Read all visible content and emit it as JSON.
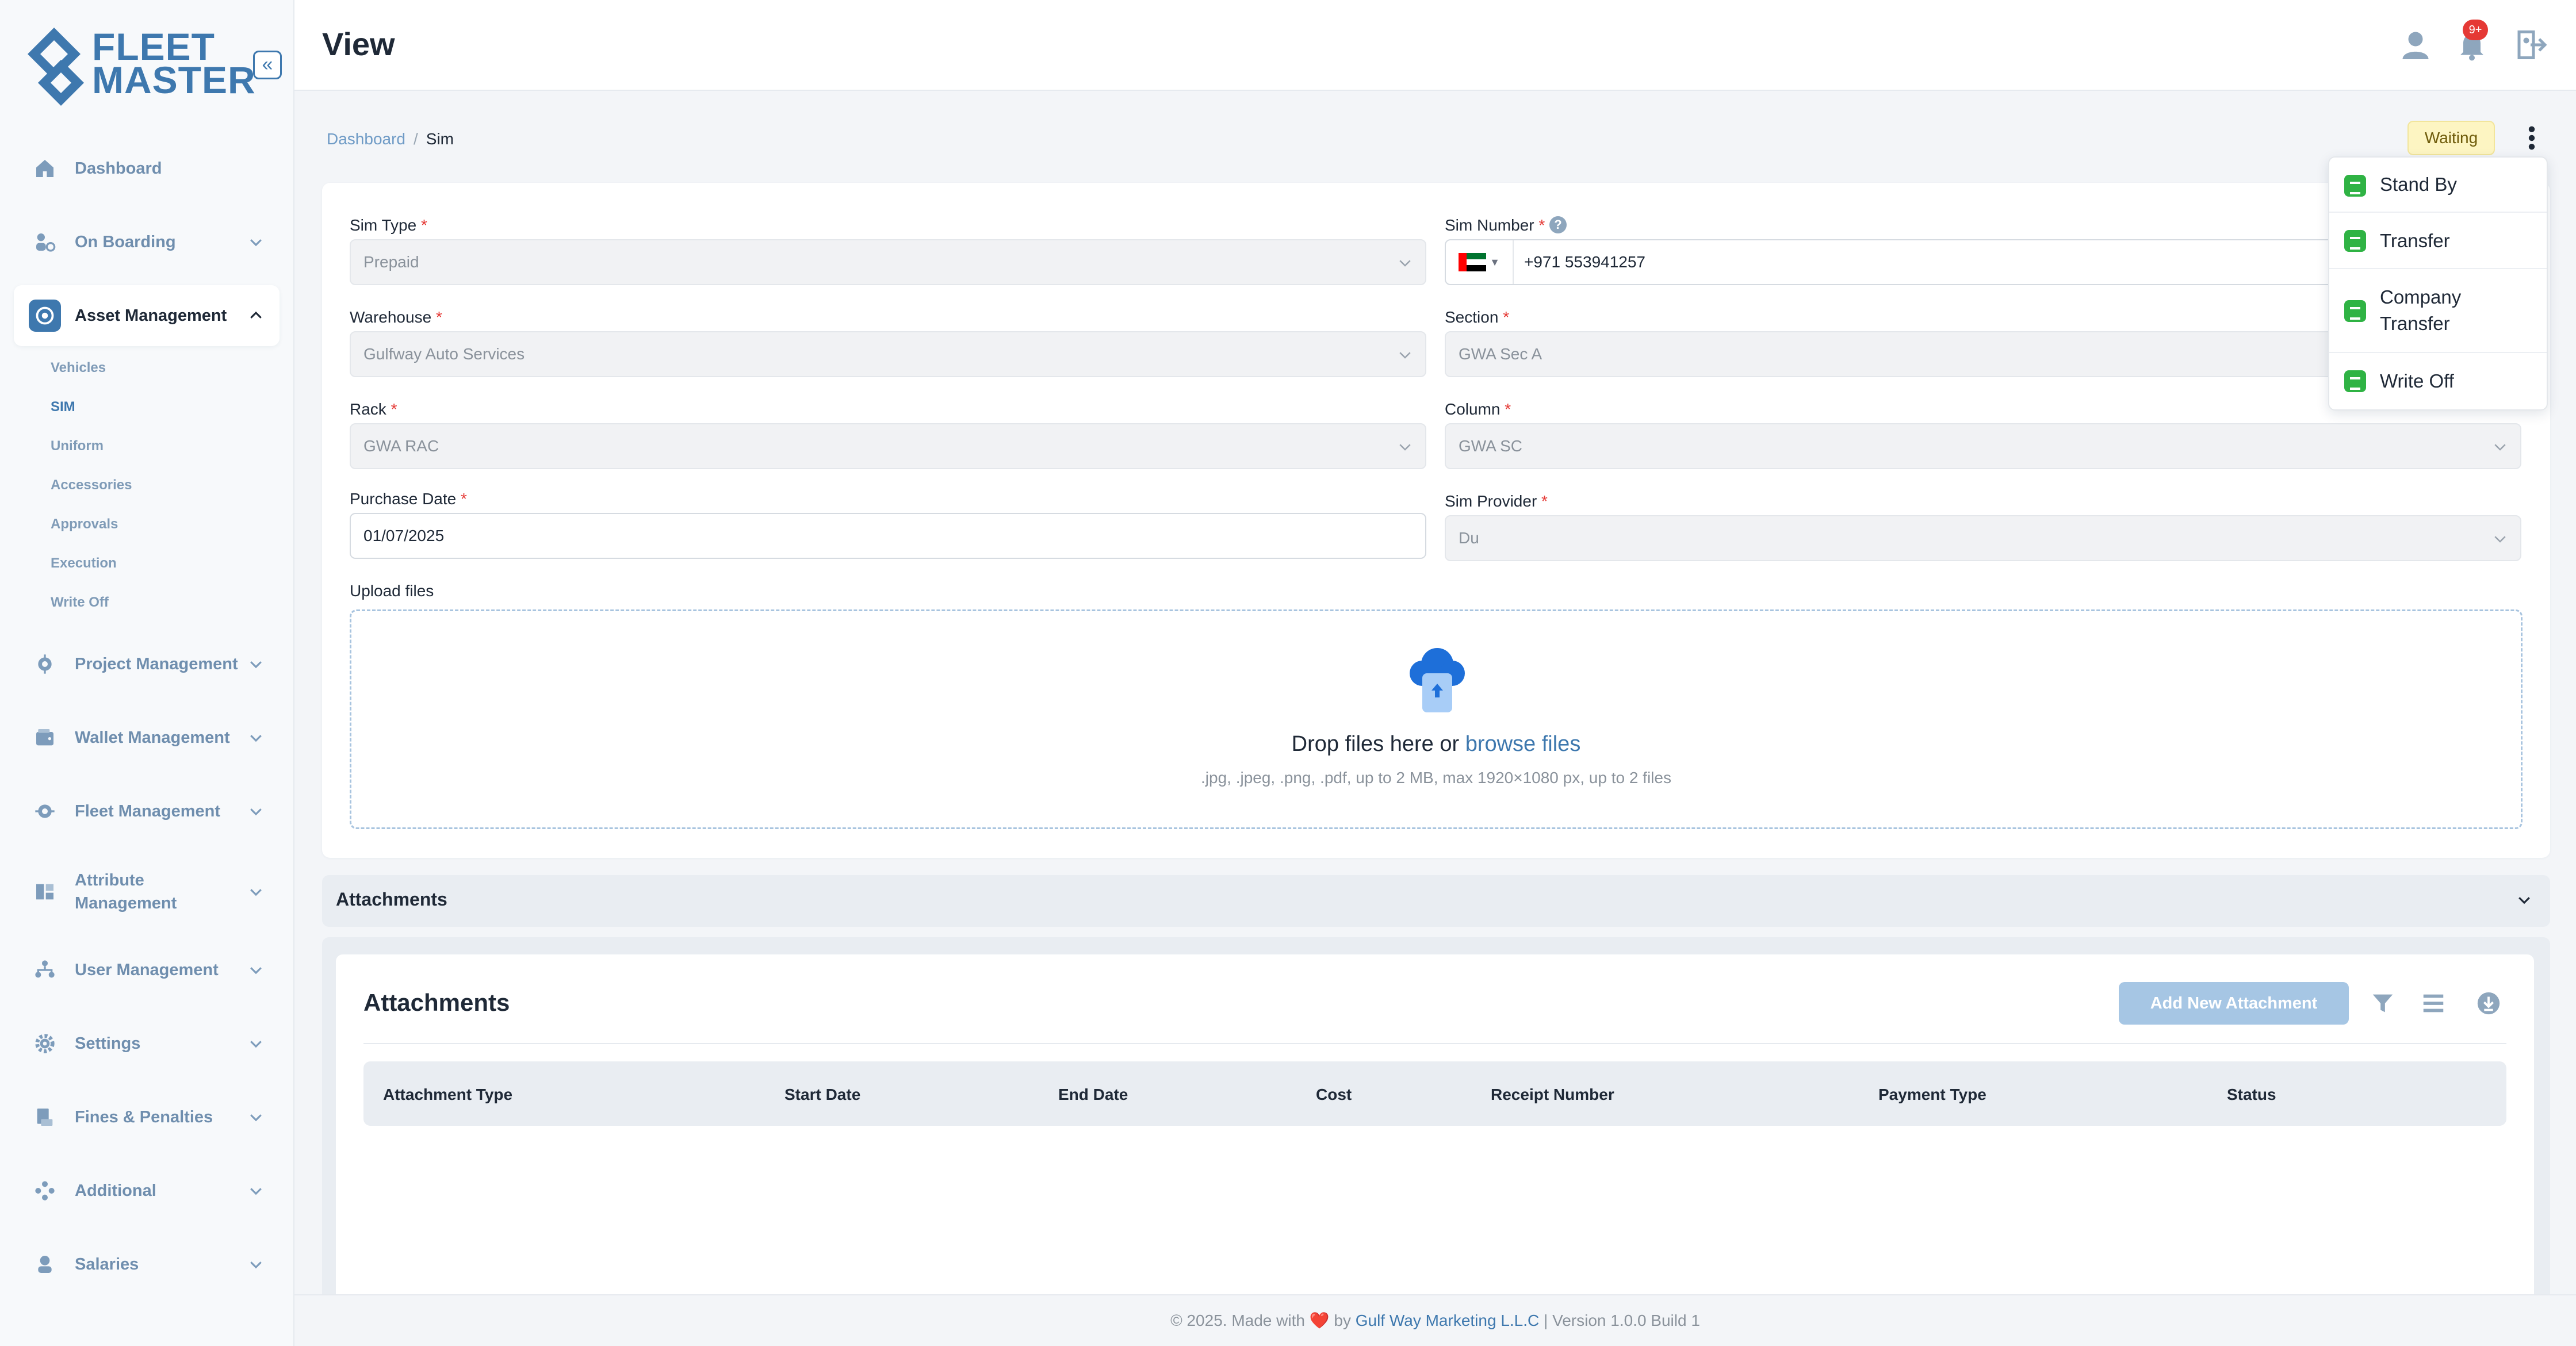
{
  "app": {
    "logo_line1": "FLEET",
    "logo_line2": "MASTER",
    "brand_color": "#3e78ae"
  },
  "sidebar": {
    "items": [
      {
        "label": "Dashboard",
        "icon": "home-icon"
      },
      {
        "label": "On Boarding",
        "icon": "onboarding-icon"
      },
      {
        "label": "Asset Management",
        "icon": "asset-icon",
        "expanded": true
      },
      {
        "label": "Project Management",
        "icon": "project-icon"
      },
      {
        "label": "Wallet Management",
        "icon": "wallet-icon"
      },
      {
        "label": "Fleet Management",
        "icon": "fleet-icon"
      },
      {
        "label": "Attribute Management",
        "icon": "attribute-icon"
      },
      {
        "label": "User Management",
        "icon": "users-icon"
      },
      {
        "label": "Settings",
        "icon": "gear-icon"
      },
      {
        "label": "Fines & Penalties",
        "icon": "fines-icon"
      },
      {
        "label": "Additional",
        "icon": "additional-icon"
      },
      {
        "label": "Salaries",
        "icon": "salaries-icon"
      }
    ],
    "subitems": [
      "Vehicles",
      "SIM",
      "Uniform",
      "Accessories",
      "Approvals",
      "Execution",
      "Write Off"
    ],
    "active_subitem": "SIM"
  },
  "header": {
    "title": "View",
    "notification_count": "9+"
  },
  "breadcrumb": {
    "parent": "Dashboard",
    "separator": "/",
    "current": "Sim"
  },
  "status": {
    "label": "Waiting",
    "menu": [
      "Stand By",
      "Transfer",
      "Company Transfer",
      "Write Off"
    ]
  },
  "form": {
    "sim_type": {
      "label": "Sim Type",
      "value": "Prepaid"
    },
    "sim_number": {
      "label": "Sim Number",
      "value": "+971 553941257",
      "country": "AE"
    },
    "warehouse": {
      "label": "Warehouse",
      "value": "Gulfway Auto Services"
    },
    "section": {
      "label": "Section",
      "value": "GWA Sec A"
    },
    "rack": {
      "label": "Rack",
      "value": "GWA RAC"
    },
    "column": {
      "label": "Column",
      "value": "GWA SC"
    },
    "purchase_date": {
      "label": "Purchase Date",
      "value": "01/07/2025"
    },
    "sim_provider": {
      "label": "Sim Provider",
      "value": "Du"
    },
    "required_mark": "*",
    "help_mark": "?",
    "upload": {
      "label": "Upload files",
      "drop_text": "Drop files here or",
      "browse_text": "browse files",
      "hint": ".jpg, .jpeg, .png, .pdf, up to 2 MB, max 1920×1080 px, up to 2 files"
    }
  },
  "attachments": {
    "accordion_title": "Attachments",
    "panel_title": "Attachments",
    "add_button": "Add New Attachment",
    "columns": [
      "Attachment Type",
      "Start Date",
      "End Date",
      "Cost",
      "Receipt Number",
      "Payment Type",
      "Status"
    ],
    "rows": []
  },
  "footer": {
    "prefix": "© 2025. Made with",
    "heart": "❤️",
    "by": "by",
    "company": "Gulf Way Marketing L.L.C",
    "version": "| Version 1.0.0 Build 1"
  }
}
